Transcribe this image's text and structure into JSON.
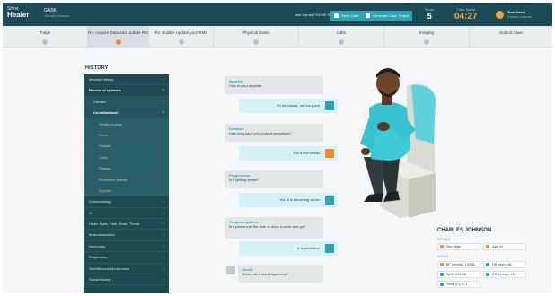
{
  "topbar": {
    "logo_small": "Shine",
    "logo_main": "Healer",
    "case_code": "GASK",
    "case_sub": "Visuals Session",
    "user_text": "Jost Sanod  PHONE SESSION",
    "btn_1": "Send Case",
    "btn_2": "Generate Case Output",
    "score_label": "Score",
    "score_value": "5",
    "time_label": "Time Spent",
    "time_value": "04:27",
    "user_name": "Tina Oasis",
    "user_role": "Kaplan Learner"
  },
  "tabs": [
    {
      "label": "Triage"
    },
    {
      "label": "Rx: Acquire Data and Update RM",
      "active": true
    },
    {
      "label": "Rx: Builder Update your RMs"
    },
    {
      "label": "Physical Exam"
    },
    {
      "label": "Labs"
    },
    {
      "label": "Imaging"
    },
    {
      "label": "Submit Case"
    }
  ],
  "history": {
    "title": "HISTORY",
    "items": [
      {
        "label": "Medical History",
        "level": 0
      },
      {
        "label": "Review of systems",
        "level": 0,
        "hl": true
      },
      {
        "label": "Cardiac",
        "level": 1
      },
      {
        "label": "Constitutional",
        "level": 1,
        "hl": true
      },
      {
        "label": "Weight change",
        "level": 2
      },
      {
        "label": "Fever",
        "level": 2
      },
      {
        "label": "Fatigue",
        "level": 2
      },
      {
        "label": "Chills",
        "level": 2
      },
      {
        "label": "Fatigue",
        "level": 2
      },
      {
        "label": "Excessive sweats",
        "level": 2
      },
      {
        "label": "Appetite",
        "level": 2,
        "acc": true
      },
      {
        "label": "Endocrinology",
        "level": 0
      },
      {
        "label": "GI",
        "level": 0
      },
      {
        "label": "Head, Eyes, Ears, Nose, Throat",
        "level": 0
      },
      {
        "label": "Musculoskeletal",
        "level": 0
      },
      {
        "label": "Neurology",
        "level": 0
      },
      {
        "label": "Respiratory",
        "level": 0
      },
      {
        "label": "Skin/Mucous Membranes",
        "level": 0
      },
      {
        "label": "Social History",
        "level": 0
      }
    ]
  },
  "chat": [
    {
      "q_title": "Appetite",
      "q": "How is your appetite",
      "a": "To be honest, not too good"
    },
    {
      "q_title": "Duration",
      "q": "How long have you noticed symptoms?",
      "a": "For a few weeks"
    },
    {
      "q_title": "Progression",
      "q": "Is it getting worse?",
      "a": "Yes, it is becoming worse"
    },
    {
      "q_title": "Temporal pattern",
      "q": "Is it present all the time or does it come and go?",
      "a": "It is persistent"
    },
    {
      "q_title": "Onset",
      "q": "When did it start happening?",
      "a": ""
    }
  ],
  "patient": {
    "name": "CHARLES JOHNSON",
    "details_label": "DETAILS",
    "sex": "Sex: Male",
    "age": "Age: 51",
    "vitals_label": "VITALS",
    "bp": "BP (mmHg): 130/85",
    "hr": "HR (bpm): 84",
    "spo2": "SpO2 (%): 98",
    "rr": "RR (br/min): 16",
    "temp": "Temp (C): 37.1"
  },
  "colors": {
    "topbar": "#1d4b55",
    "accent": "#2aa3b3",
    "orange": "#f08a2c",
    "sidebar": "#1f4a52"
  }
}
